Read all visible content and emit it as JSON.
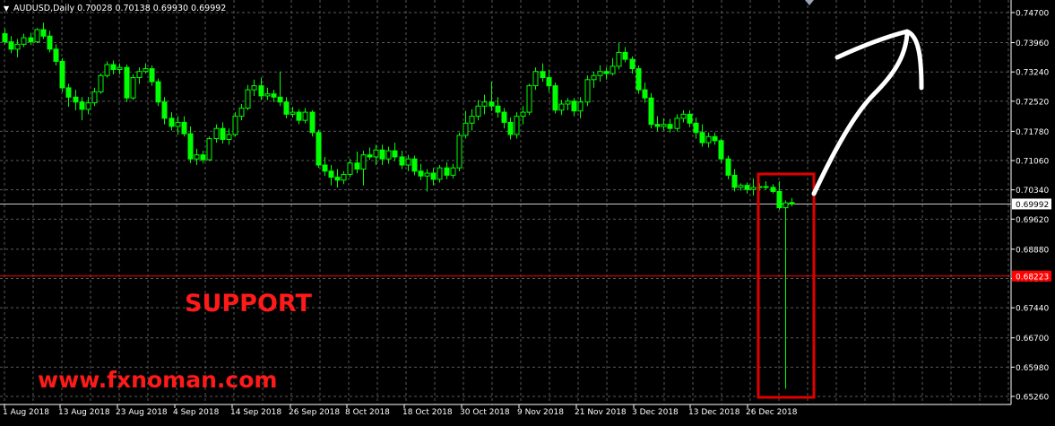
{
  "header": {
    "arrow": "▼",
    "text": "AUDUSD,Daily  0.70028 0.70138 0.69930 0.69992"
  },
  "annotations": {
    "support_label": "SUPPORT",
    "website": "www.fxnoman.com"
  },
  "colors": {
    "background": "#000000",
    "grid": "#5a5a5a",
    "candle": "#00ff00",
    "axis_text": "#ffffff",
    "support_line": "#ff0000",
    "highlight_box": "#e00000",
    "annotation_text": "#ff1a1a",
    "arrow": "#ffffff"
  },
  "chart_data": {
    "type": "candlestick",
    "symbol": "AUDUSD",
    "timeframe": "Daily",
    "ylim": [
      0.6518,
      0.7504
    ],
    "y_ticks": [
      "0.74700",
      "0.73960",
      "0.73240",
      "0.72520",
      "0.71780",
      "0.71060",
      "0.70340",
      "0.69620",
      "0.68880",
      "0.68160",
      "0.67440",
      "0.66700",
      "0.65980",
      "0.65260"
    ],
    "x_labels": [
      "1 Aug 2018",
      "13 Aug 2018",
      "23 Aug 2018",
      "4 Sep 2018",
      "14 Sep 2018",
      "26 Sep 2018",
      "8 Oct 2018",
      "18 Oct 2018",
      "30 Oct 2018",
      "9 Nov 2018",
      "21 Nov 2018",
      "3 Dec 2018",
      "13 Dec 2018",
      "26 Dec 2018"
    ],
    "current_price": "0.69992",
    "support_level": 0.6822,
    "support_label": "0.68223",
    "grid": true,
    "candles": [
      {
        "date": "2018-07-30",
        "o": 0.7418,
        "h": 0.743,
        "l": 0.7392,
        "c": 0.7398
      },
      {
        "date": "2018-07-31",
        "o": 0.7398,
        "h": 0.7412,
        "l": 0.737,
        "c": 0.738
      },
      {
        "date": "2018-08-01",
        "o": 0.738,
        "h": 0.7405,
        "l": 0.736,
        "c": 0.7392
      },
      {
        "date": "2018-08-02",
        "o": 0.7392,
        "h": 0.7418,
        "l": 0.7385,
        "c": 0.7408
      },
      {
        "date": "2018-08-03",
        "o": 0.7408,
        "h": 0.742,
        "l": 0.739,
        "c": 0.7398
      },
      {
        "date": "2018-08-06",
        "o": 0.7398,
        "h": 0.7432,
        "l": 0.7395,
        "c": 0.7428
      },
      {
        "date": "2018-08-07",
        "o": 0.7428,
        "h": 0.7445,
        "l": 0.7405,
        "c": 0.7412
      },
      {
        "date": "2018-08-08",
        "o": 0.7412,
        "h": 0.7425,
        "l": 0.7372,
        "c": 0.738
      },
      {
        "date": "2018-08-09",
        "o": 0.738,
        "h": 0.7392,
        "l": 0.734,
        "c": 0.735
      },
      {
        "date": "2018-08-10",
        "o": 0.735,
        "h": 0.7358,
        "l": 0.7275,
        "c": 0.7285
      },
      {
        "date": "2018-08-13",
        "o": 0.7285,
        "h": 0.7295,
        "l": 0.7238,
        "c": 0.7262
      },
      {
        "date": "2018-08-14",
        "o": 0.7262,
        "h": 0.728,
        "l": 0.723,
        "c": 0.725
      },
      {
        "date": "2018-08-15",
        "o": 0.725,
        "h": 0.7262,
        "l": 0.7205,
        "c": 0.7232
      },
      {
        "date": "2018-08-16",
        "o": 0.7232,
        "h": 0.7262,
        "l": 0.722,
        "c": 0.7248
      },
      {
        "date": "2018-08-17",
        "o": 0.7248,
        "h": 0.7285,
        "l": 0.724,
        "c": 0.7275
      },
      {
        "date": "2018-08-20",
        "o": 0.7275,
        "h": 0.732,
        "l": 0.727,
        "c": 0.7315
      },
      {
        "date": "2018-08-21",
        "o": 0.7315,
        "h": 0.735,
        "l": 0.731,
        "c": 0.7342
      },
      {
        "date": "2018-08-22",
        "o": 0.7342,
        "h": 0.7352,
        "l": 0.7318,
        "c": 0.733
      },
      {
        "date": "2018-08-23",
        "o": 0.733,
        "h": 0.7345,
        "l": 0.7318,
        "c": 0.7335
      },
      {
        "date": "2018-08-24",
        "o": 0.7335,
        "h": 0.7342,
        "l": 0.725,
        "c": 0.726
      },
      {
        "date": "2018-08-27",
        "o": 0.726,
        "h": 0.7318,
        "l": 0.7255,
        "c": 0.731
      },
      {
        "date": "2018-08-28",
        "o": 0.731,
        "h": 0.7335,
        "l": 0.7295,
        "c": 0.7325
      },
      {
        "date": "2018-08-29",
        "o": 0.7325,
        "h": 0.7345,
        "l": 0.732,
        "c": 0.7332
      },
      {
        "date": "2018-08-30",
        "o": 0.7332,
        "h": 0.734,
        "l": 0.729,
        "c": 0.73
      },
      {
        "date": "2018-08-31",
        "o": 0.73,
        "h": 0.7308,
        "l": 0.724,
        "c": 0.725
      },
      {
        "date": "2018-09-03",
        "o": 0.725,
        "h": 0.7262,
        "l": 0.7195,
        "c": 0.721
      },
      {
        "date": "2018-09-04",
        "o": 0.721,
        "h": 0.7225,
        "l": 0.718,
        "c": 0.719
      },
      {
        "date": "2018-09-05",
        "o": 0.719,
        "h": 0.7215,
        "l": 0.717,
        "c": 0.72
      },
      {
        "date": "2018-09-06",
        "o": 0.72,
        "h": 0.7215,
        "l": 0.7165,
        "c": 0.7172
      },
      {
        "date": "2018-09-07",
        "o": 0.7172,
        "h": 0.719,
        "l": 0.71,
        "c": 0.711
      },
      {
        "date": "2018-09-10",
        "o": 0.711,
        "h": 0.7135,
        "l": 0.7095,
        "c": 0.712
      },
      {
        "date": "2018-09-11",
        "o": 0.712,
        "h": 0.713,
        "l": 0.71,
        "c": 0.7108
      },
      {
        "date": "2018-09-12",
        "o": 0.7108,
        "h": 0.7165,
        "l": 0.7105,
        "c": 0.716
      },
      {
        "date": "2018-09-13",
        "o": 0.716,
        "h": 0.7195,
        "l": 0.715,
        "c": 0.7185
      },
      {
        "date": "2018-09-14",
        "o": 0.7185,
        "h": 0.72,
        "l": 0.7148,
        "c": 0.7158
      },
      {
        "date": "2018-09-17",
        "o": 0.7158,
        "h": 0.7185,
        "l": 0.7145,
        "c": 0.717
      },
      {
        "date": "2018-09-18",
        "o": 0.717,
        "h": 0.7225,
        "l": 0.7165,
        "c": 0.7215
      },
      {
        "date": "2018-09-19",
        "o": 0.7215,
        "h": 0.7245,
        "l": 0.7205,
        "c": 0.7235
      },
      {
        "date": "2018-09-20",
        "o": 0.7235,
        "h": 0.7292,
        "l": 0.723,
        "c": 0.728
      },
      {
        "date": "2018-09-21",
        "o": 0.728,
        "h": 0.7305,
        "l": 0.7265,
        "c": 0.729
      },
      {
        "date": "2018-09-24",
        "o": 0.729,
        "h": 0.731,
        "l": 0.7255,
        "c": 0.7265
      },
      {
        "date": "2018-09-25",
        "o": 0.7265,
        "h": 0.7285,
        "l": 0.7255,
        "c": 0.727
      },
      {
        "date": "2018-09-26",
        "o": 0.727,
        "h": 0.728,
        "l": 0.725,
        "c": 0.7262
      },
      {
        "date": "2018-09-27",
        "o": 0.7262,
        "h": 0.7325,
        "l": 0.724,
        "c": 0.725
      },
      {
        "date": "2018-09-28",
        "o": 0.725,
        "h": 0.7262,
        "l": 0.721,
        "c": 0.722
      },
      {
        "date": "2018-10-01",
        "o": 0.722,
        "h": 0.7238,
        "l": 0.7212,
        "c": 0.7225
      },
      {
        "date": "2018-10-02",
        "o": 0.7225,
        "h": 0.7232,
        "l": 0.7195,
        "c": 0.7205
      },
      {
        "date": "2018-10-03",
        "o": 0.7205,
        "h": 0.7235,
        "l": 0.7198,
        "c": 0.7225
      },
      {
        "date": "2018-10-04",
        "o": 0.7225,
        "h": 0.723,
        "l": 0.7165,
        "c": 0.7175
      },
      {
        "date": "2018-10-05",
        "o": 0.7175,
        "h": 0.7182,
        "l": 0.7088,
        "c": 0.7095
      },
      {
        "date": "2018-10-08",
        "o": 0.7095,
        "h": 0.7115,
        "l": 0.7068,
        "c": 0.708
      },
      {
        "date": "2018-10-09",
        "o": 0.708,
        "h": 0.7095,
        "l": 0.7045,
        "c": 0.7065
      },
      {
        "date": "2018-10-10",
        "o": 0.7065,
        "h": 0.7085,
        "l": 0.704,
        "c": 0.7058
      },
      {
        "date": "2018-10-11",
        "o": 0.7058,
        "h": 0.708,
        "l": 0.7048,
        "c": 0.7072
      },
      {
        "date": "2018-10-12",
        "o": 0.7072,
        "h": 0.711,
        "l": 0.7065,
        "c": 0.71
      },
      {
        "date": "2018-10-15",
        "o": 0.71,
        "h": 0.7128,
        "l": 0.7075,
        "c": 0.7085
      },
      {
        "date": "2018-10-16",
        "o": 0.7085,
        "h": 0.713,
        "l": 0.7045,
        "c": 0.712
      },
      {
        "date": "2018-10-17",
        "o": 0.712,
        "h": 0.7138,
        "l": 0.7108,
        "c": 0.7115
      },
      {
        "date": "2018-10-18",
        "o": 0.7115,
        "h": 0.7145,
        "l": 0.7095,
        "c": 0.7132
      },
      {
        "date": "2018-10-19",
        "o": 0.7132,
        "h": 0.7145,
        "l": 0.7095,
        "c": 0.711
      },
      {
        "date": "2018-10-22",
        "o": 0.711,
        "h": 0.714,
        "l": 0.7098,
        "c": 0.713
      },
      {
        "date": "2018-10-23",
        "o": 0.713,
        "h": 0.715,
        "l": 0.7105,
        "c": 0.7115
      },
      {
        "date": "2018-10-24",
        "o": 0.7115,
        "h": 0.713,
        "l": 0.7085,
        "c": 0.7095
      },
      {
        "date": "2018-10-25",
        "o": 0.7095,
        "h": 0.712,
        "l": 0.708,
        "c": 0.711
      },
      {
        "date": "2018-10-26",
        "o": 0.711,
        "h": 0.7118,
        "l": 0.707,
        "c": 0.708
      },
      {
        "date": "2018-10-29",
        "o": 0.708,
        "h": 0.7098,
        "l": 0.7058,
        "c": 0.7068
      },
      {
        "date": "2018-10-30",
        "o": 0.7068,
        "h": 0.7085,
        "l": 0.703,
        "c": 0.7075
      },
      {
        "date": "2018-10-31",
        "o": 0.7075,
        "h": 0.7088,
        "l": 0.7045,
        "c": 0.706
      },
      {
        "date": "2018-11-01",
        "o": 0.706,
        "h": 0.7095,
        "l": 0.7052,
        "c": 0.7088
      },
      {
        "date": "2018-11-02",
        "o": 0.7088,
        "h": 0.7102,
        "l": 0.706,
        "c": 0.707
      },
      {
        "date": "2018-11-05",
        "o": 0.707,
        "h": 0.7098,
        "l": 0.7062,
        "c": 0.7088
      },
      {
        "date": "2018-11-06",
        "o": 0.7088,
        "h": 0.7175,
        "l": 0.708,
        "c": 0.7168
      },
      {
        "date": "2018-11-07",
        "o": 0.7168,
        "h": 0.7228,
        "l": 0.716,
        "c": 0.7198
      },
      {
        "date": "2018-11-08",
        "o": 0.7198,
        "h": 0.7232,
        "l": 0.718,
        "c": 0.7215
      },
      {
        "date": "2018-11-09",
        "o": 0.7215,
        "h": 0.7255,
        "l": 0.7205,
        "c": 0.724
      },
      {
        "date": "2018-11-12",
        "o": 0.724,
        "h": 0.7268,
        "l": 0.722,
        "c": 0.725
      },
      {
        "date": "2018-11-13",
        "o": 0.725,
        "h": 0.73,
        "l": 0.7228,
        "c": 0.724
      },
      {
        "date": "2018-11-14",
        "o": 0.724,
        "h": 0.7262,
        "l": 0.7212,
        "c": 0.7225
      },
      {
        "date": "2018-11-15",
        "o": 0.7225,
        "h": 0.7235,
        "l": 0.7185,
        "c": 0.72
      },
      {
        "date": "2018-11-16",
        "o": 0.72,
        "h": 0.7212,
        "l": 0.7158,
        "c": 0.717
      },
      {
        "date": "2018-11-19",
        "o": 0.717,
        "h": 0.7225,
        "l": 0.716,
        "c": 0.7215
      },
      {
        "date": "2018-11-20",
        "o": 0.7215,
        "h": 0.724,
        "l": 0.7195,
        "c": 0.7225
      },
      {
        "date": "2018-11-21",
        "o": 0.7225,
        "h": 0.7295,
        "l": 0.7218,
        "c": 0.729
      },
      {
        "date": "2018-11-22",
        "o": 0.729,
        "h": 0.7335,
        "l": 0.728,
        "c": 0.7325
      },
      {
        "date": "2018-11-23",
        "o": 0.7325,
        "h": 0.7345,
        "l": 0.73,
        "c": 0.731
      },
      {
        "date": "2018-11-26",
        "o": 0.731,
        "h": 0.733,
        "l": 0.7275,
        "c": 0.729
      },
      {
        "date": "2018-11-27",
        "o": 0.729,
        "h": 0.7298,
        "l": 0.7222,
        "c": 0.723
      },
      {
        "date": "2018-11-28",
        "o": 0.723,
        "h": 0.7255,
        "l": 0.7218,
        "c": 0.7245
      },
      {
        "date": "2018-11-29",
        "o": 0.7245,
        "h": 0.726,
        "l": 0.723,
        "c": 0.7252
      },
      {
        "date": "2018-11-30",
        "o": 0.7252,
        "h": 0.726,
        "l": 0.7215,
        "c": 0.7228
      },
      {
        "date": "2018-12-03",
        "o": 0.7228,
        "h": 0.7262,
        "l": 0.721,
        "c": 0.725
      },
      {
        "date": "2018-12-04",
        "o": 0.725,
        "h": 0.7315,
        "l": 0.724,
        "c": 0.7305
      },
      {
        "date": "2018-12-05",
        "o": 0.7305,
        "h": 0.7325,
        "l": 0.7285,
        "c": 0.7315
      },
      {
        "date": "2018-12-06",
        "o": 0.7315,
        "h": 0.734,
        "l": 0.73,
        "c": 0.7325
      },
      {
        "date": "2018-12-07",
        "o": 0.7325,
        "h": 0.7335,
        "l": 0.7305,
        "c": 0.732
      },
      {
        "date": "2018-12-10",
        "o": 0.732,
        "h": 0.7358,
        "l": 0.7315,
        "c": 0.7338
      },
      {
        "date": "2018-12-11",
        "o": 0.7338,
        "h": 0.7395,
        "l": 0.733,
        "c": 0.7372
      },
      {
        "date": "2018-12-12",
        "o": 0.7372,
        "h": 0.7385,
        "l": 0.7348,
        "c": 0.7355
      },
      {
        "date": "2018-12-13",
        "o": 0.7355,
        "h": 0.7362,
        "l": 0.732,
        "c": 0.7332
      },
      {
        "date": "2018-12-14",
        "o": 0.7332,
        "h": 0.734,
        "l": 0.727,
        "c": 0.728
      },
      {
        "date": "2018-12-17",
        "o": 0.728,
        "h": 0.7298,
        "l": 0.7248,
        "c": 0.726
      },
      {
        "date": "2018-12-18",
        "o": 0.726,
        "h": 0.7272,
        "l": 0.7185,
        "c": 0.7195
      },
      {
        "date": "2018-12-19",
        "o": 0.7195,
        "h": 0.7215,
        "l": 0.7178,
        "c": 0.719
      },
      {
        "date": "2018-12-20",
        "o": 0.719,
        "h": 0.721,
        "l": 0.718,
        "c": 0.7195
      },
      {
        "date": "2018-12-21",
        "o": 0.7195,
        "h": 0.7208,
        "l": 0.7175,
        "c": 0.7185
      },
      {
        "date": "2018-12-24",
        "o": 0.7185,
        "h": 0.722,
        "l": 0.7178,
        "c": 0.721
      },
      {
        "date": "2018-12-25",
        "o": 0.721,
        "h": 0.723,
        "l": 0.72,
        "c": 0.722
      },
      {
        "date": "2018-12-26",
        "o": 0.722,
        "h": 0.723,
        "l": 0.7188,
        "c": 0.7198
      },
      {
        "date": "2018-12-27",
        "o": 0.7198,
        "h": 0.7212,
        "l": 0.716,
        "c": 0.7175
      },
      {
        "date": "2018-12-28",
        "o": 0.7175,
        "h": 0.7195,
        "l": 0.714,
        "c": 0.715
      },
      {
        "date": "2018-12-31",
        "o": 0.715,
        "h": 0.7175,
        "l": 0.7138,
        "c": 0.7165
      },
      {
        "date": "2019-01-01",
        "o": 0.7165,
        "h": 0.7175,
        "l": 0.7145,
        "c": 0.7155
      },
      {
        "date": "2019-01-02",
        "o": 0.7155,
        "h": 0.716,
        "l": 0.71,
        "c": 0.711
      },
      {
        "date": "2019-01-03",
        "o": 0.711,
        "h": 0.7118,
        "l": 0.706,
        "c": 0.707
      },
      {
        "date": "2019-01-04",
        "o": 0.707,
        "h": 0.7085,
        "l": 0.703,
        "c": 0.704
      },
      {
        "date": "2019-01-07",
        "o": 0.704,
        "h": 0.705,
        "l": 0.7032,
        "c": 0.7045
      },
      {
        "date": "2019-01-08",
        "o": 0.7045,
        "h": 0.7052,
        "l": 0.7025,
        "c": 0.7035
      },
      {
        "date": "2019-01-09",
        "o": 0.7035,
        "h": 0.7062,
        "l": 0.702,
        "c": 0.704
      },
      {
        "date": "2019-01-10",
        "o": 0.704,
        "h": 0.705,
        "l": 0.7032,
        "c": 0.7042
      },
      {
        "date": "2019-01-11",
        "o": 0.7042,
        "h": 0.7055,
        "l": 0.7035,
        "c": 0.704
      },
      {
        "date": "2019-01-14",
        "o": 0.704,
        "h": 0.7048,
        "l": 0.7025,
        "c": 0.703
      },
      {
        "date": "2019-01-15",
        "o": 0.703,
        "h": 0.7055,
        "l": 0.6985,
        "c": 0.699
      },
      {
        "date": "2019-01-16",
        "o": 0.699,
        "h": 0.7008,
        "l": 0.6545,
        "c": 0.7002
      },
      {
        "date": "2019-01-17",
        "o": 0.70028,
        "h": 0.70138,
        "l": 0.6993,
        "c": 0.69992
      }
    ]
  }
}
